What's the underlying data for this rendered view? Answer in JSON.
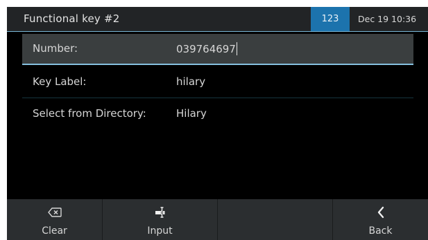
{
  "header": {
    "title": "Functional key #2",
    "mode": "123",
    "datetime": "Dec 19 10:36"
  },
  "form": {
    "rows": [
      {
        "label": "Number:",
        "value": "039764697"
      },
      {
        "label": "Key Label:",
        "value": "hilary"
      },
      {
        "label": "Select from Directory:",
        "value": "Hilary"
      }
    ]
  },
  "softkeys": {
    "clear": {
      "label": "Clear",
      "icon": "backspace-icon"
    },
    "input": {
      "label": "Input",
      "icon": "input-mode-icon"
    },
    "empty": {
      "label": ""
    },
    "back": {
      "label": "Back",
      "icon": "chevron-left-icon"
    }
  },
  "colors": {
    "accent": "#1c73ad",
    "focus_line": "#86c0e0",
    "selected_row": "#3a3e3f"
  }
}
